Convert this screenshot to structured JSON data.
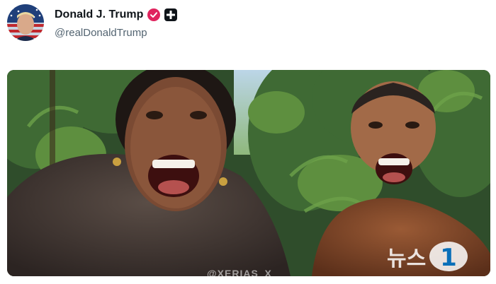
{
  "post": {
    "display_name": "Donald J. Trump",
    "handle": "@realDonaldTrump",
    "avatar_icon": "flag-portrait-avatar",
    "verified_icon": "verified-badge-icon",
    "government_icon": "government-affiliation-icon",
    "verified_color": "#e0245e"
  },
  "media": {
    "watermark": "@XERIAS_X",
    "news_logo_text": "뉴스",
    "news_logo_mark": "1",
    "news_logo_icon": "news1-logo-icon"
  }
}
